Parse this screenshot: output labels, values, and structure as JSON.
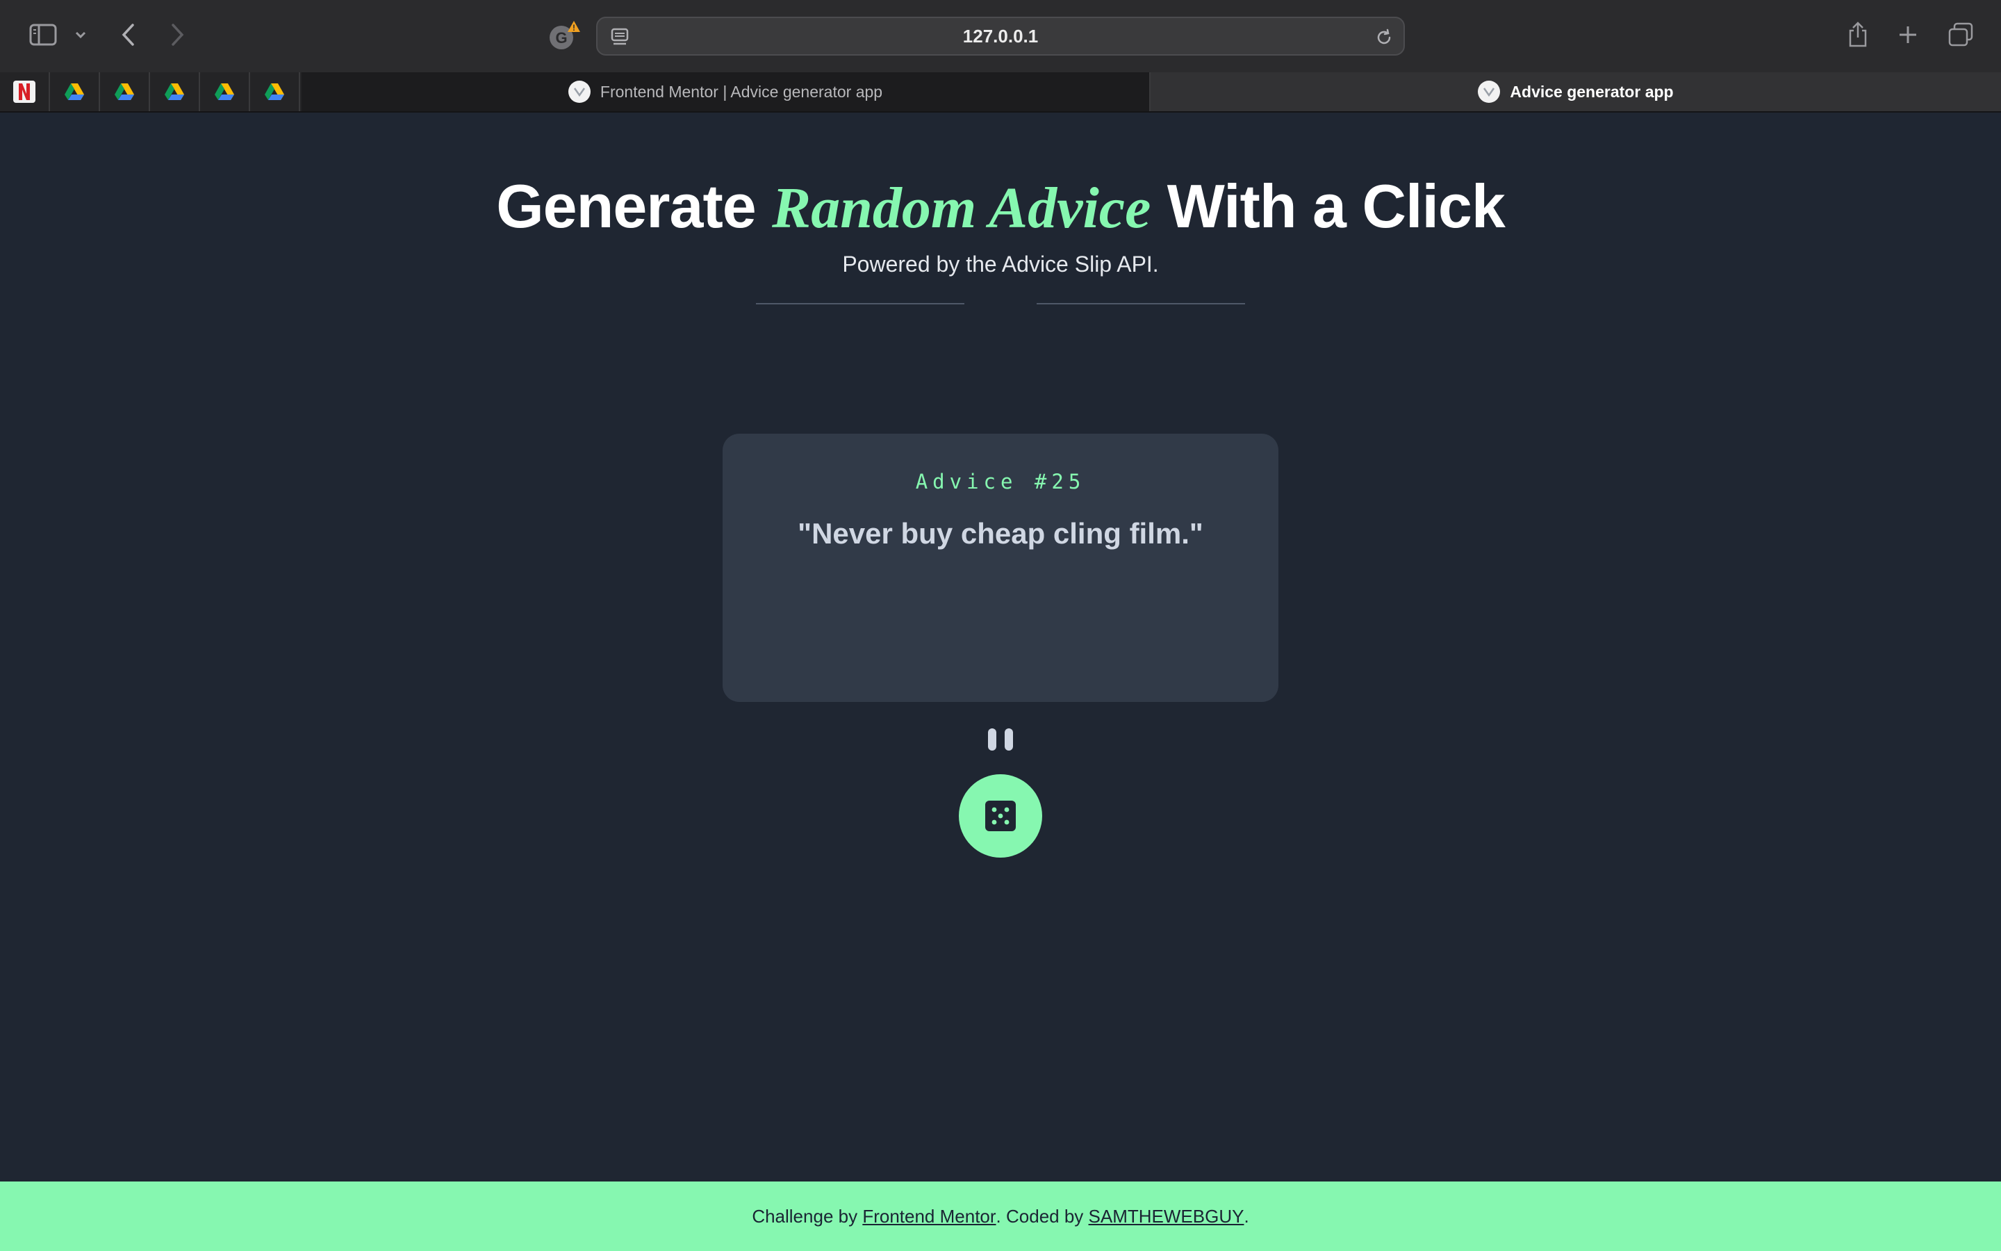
{
  "browser": {
    "url": "127.0.0.1",
    "tabs": [
      {
        "title": "Frontend Mentor | Advice generator app",
        "active": false
      },
      {
        "title": "Advice generator app",
        "active": true
      }
    ],
    "pinned_tabs": [
      "netflix-icon",
      "google-drive-icon",
      "google-drive-icon",
      "google-drive-icon",
      "google-drive-icon",
      "google-drive-icon"
    ]
  },
  "header": {
    "title_before": "Generate ",
    "title_accent": "Random Advice",
    "title_after": " With a Click",
    "subtitle": "Powered by the Advice Slip API."
  },
  "card": {
    "advice_id": "Advice #25",
    "advice_text": "\"Never buy cheap cling film.\""
  },
  "footer": {
    "prefix": "Challenge by ",
    "link1": "Frontend Mentor",
    "middle": ". Coded by ",
    "link2": "SAMTHEWEBGUY",
    "suffix": "."
  },
  "colors": {
    "accent": "#86f7b0",
    "background": "#1f2632",
    "card": "#313a48"
  }
}
